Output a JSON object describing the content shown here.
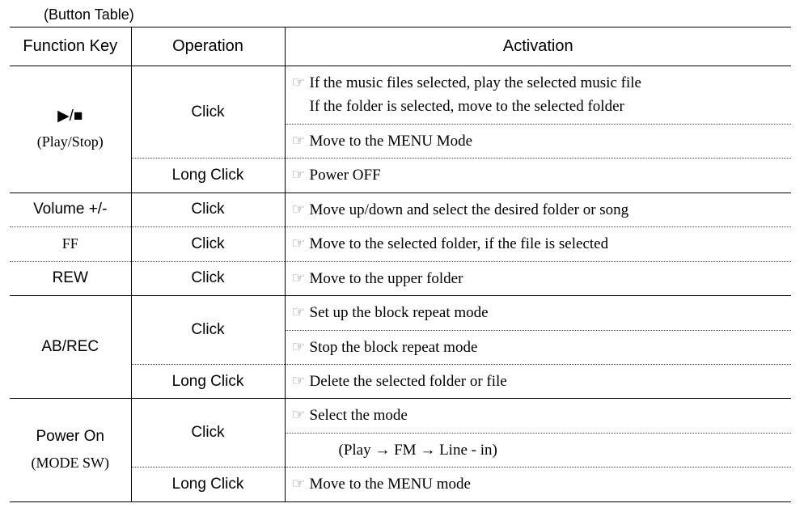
{
  "title": "(Button Table)",
  "headers": {
    "func": "Function Key",
    "op": "Operation",
    "act": "Activation"
  },
  "pointer": "☞",
  "rows": {
    "playstop": {
      "key_line1": "▶/■",
      "key_line2": "(Play/Stop)",
      "op1": "Click",
      "act1a": "If the music files selected, play the selected music file",
      "act1b": "If the folder is selected, move to the selected folder",
      "act1c": "Move to the MENU Mode",
      "op2": "Long Click",
      "act2": "Power OFF"
    },
    "vol": {
      "key": "Volume +/-",
      "op": "Click",
      "act": "Move up/down and select the desired folder or song"
    },
    "ff": {
      "key": "FF",
      "op": "Click",
      "act": "Move to the selected folder, if the file is selected"
    },
    "rew": {
      "key": "REW",
      "op": "Click",
      "act": "Move to the upper folder"
    },
    "abrec": {
      "key": "AB/REC",
      "op1": "Click",
      "act1a": "Set up the block repeat mode",
      "act1b": "Stop the block repeat mode",
      "op2": "Long Click",
      "act2": "Delete the selected folder or file"
    },
    "power": {
      "key_line1": "Power On",
      "key_line2": "(MODE SW)",
      "op1": "Click",
      "act1a": "Select the mode",
      "act1b": "(Play → FM → Line - in)",
      "op2": "Long Click",
      "act2": "Move to the MENU mode"
    }
  }
}
